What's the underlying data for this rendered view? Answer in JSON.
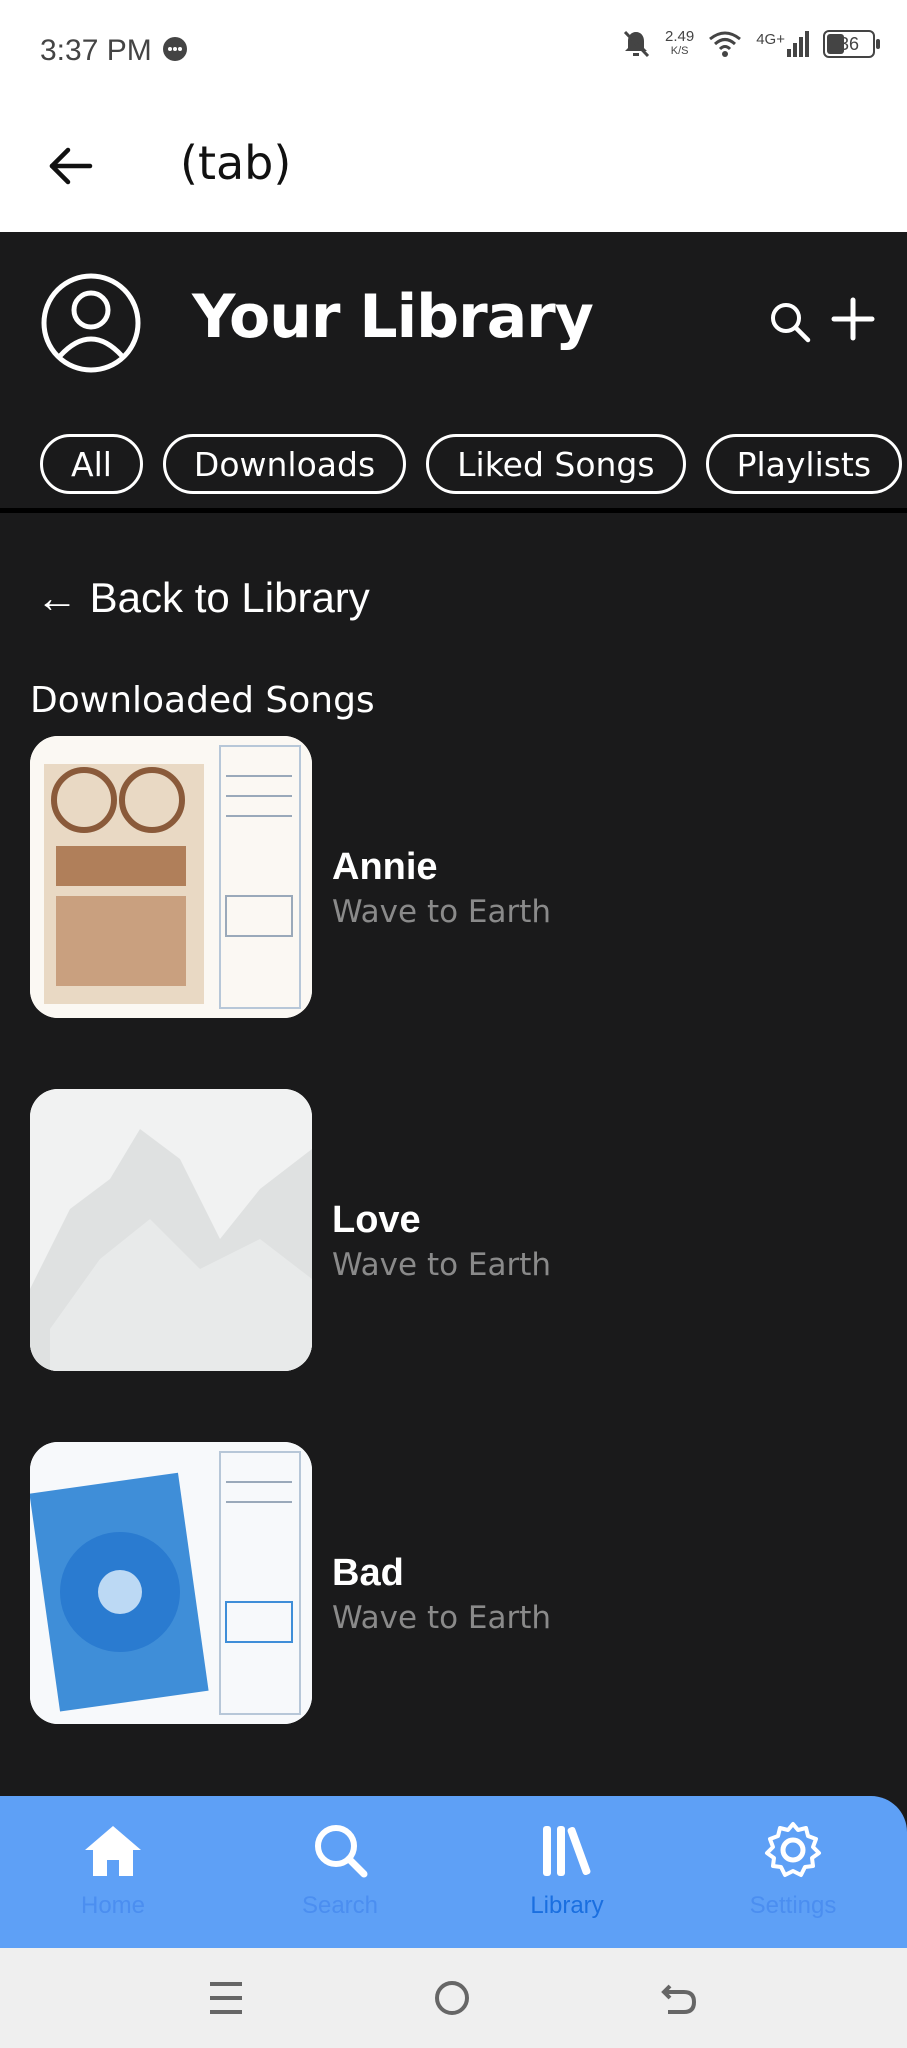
{
  "status_bar": {
    "time": "3:37 PM",
    "net_speed_value": "2.49",
    "net_speed_unit": "K/S",
    "network": "4G+",
    "battery": "36"
  },
  "app_bar": {
    "title": "(tab)"
  },
  "library": {
    "title": "Your Library",
    "chips": [
      "All",
      "Downloads",
      "Liked Songs",
      "Playlists"
    ]
  },
  "back_link": "← Back to Library",
  "section_title": "Downloaded Songs",
  "songs": [
    {
      "title": "Annie",
      "artist": "Wave to Earth"
    },
    {
      "title": "Love",
      "artist": "Wave to Earth"
    },
    {
      "title": "Bad",
      "artist": "Wave to Earth"
    }
  ],
  "bottom_nav": {
    "items": [
      {
        "label": "Home",
        "icon": "home-icon"
      },
      {
        "label": "Search",
        "icon": "search-icon"
      },
      {
        "label": "Library",
        "icon": "library-icon"
      },
      {
        "label": "Settings",
        "icon": "gear-icon"
      }
    ],
    "active": "Library"
  },
  "colors": {
    "background": "#1a1a1b",
    "nav_bg": "#5ea0f6",
    "nav_active_label": "#1a6fe0",
    "artist_text": "#8a8a8a"
  }
}
